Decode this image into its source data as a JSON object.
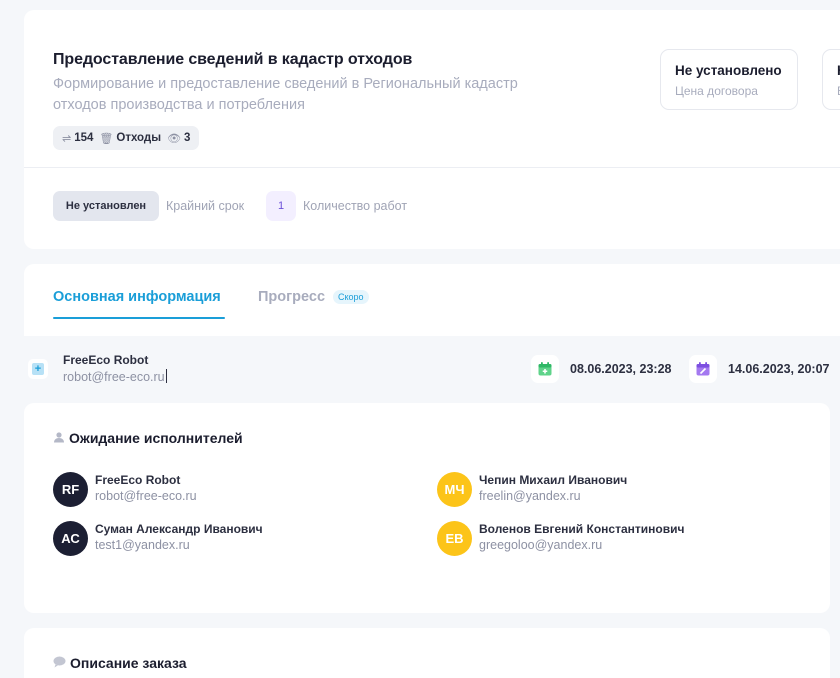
{
  "header": {
    "title": "Предоставление сведений в кадастр отходов",
    "subtitle": "Формирование и предоставление сведений в Региональный кадастр отходов производства и потребления",
    "chips": {
      "code": "154",
      "category": "Отходы",
      "views": "3"
    },
    "price": {
      "value": "Не установлено",
      "label": "Цена договора"
    },
    "box2": {
      "value_partial": "Н",
      "label_partial": "Б"
    },
    "deadline": {
      "value": "Не установлен",
      "label": "Крайний срок"
    },
    "works": {
      "count": "1",
      "label": "Количество работ"
    }
  },
  "tabs": {
    "main": "Основная информация",
    "progress": "Прогресс",
    "soon_badge": "Скоро"
  },
  "author": {
    "name": "FreeEco Robot",
    "email": "robot@free-eco.ru"
  },
  "dates": {
    "created": "08.06.2023, 23:28",
    "updated": "14.06.2023, 20:07"
  },
  "waiting": {
    "title": "Ожидание исполнителей",
    "people": [
      {
        "initials": "RF",
        "name": "FreeEco Robot",
        "email": "robot@free-eco.ru",
        "color": "#1c1f33"
      },
      {
        "initials": "МЧ",
        "name": "Чепин Михаил Иванович",
        "email": "freelin@yandex.ru",
        "color": "#fcc419"
      },
      {
        "initials": "АС",
        "name": "Суман Александр Иванович",
        "email": "test1@yandex.ru",
        "color": "#1c1f33"
      },
      {
        "initials": "ЕВ",
        "name": "Воленов Евгений Константинович",
        "email": "greegoloo@yandex.ru",
        "color": "#fcc419"
      }
    ]
  },
  "description": {
    "title": "Описание заказа"
  },
  "colors": {
    "accent": "#1a9ed8",
    "avatar_dark": "#1c1f33",
    "avatar_yellow": "#fcc419"
  }
}
